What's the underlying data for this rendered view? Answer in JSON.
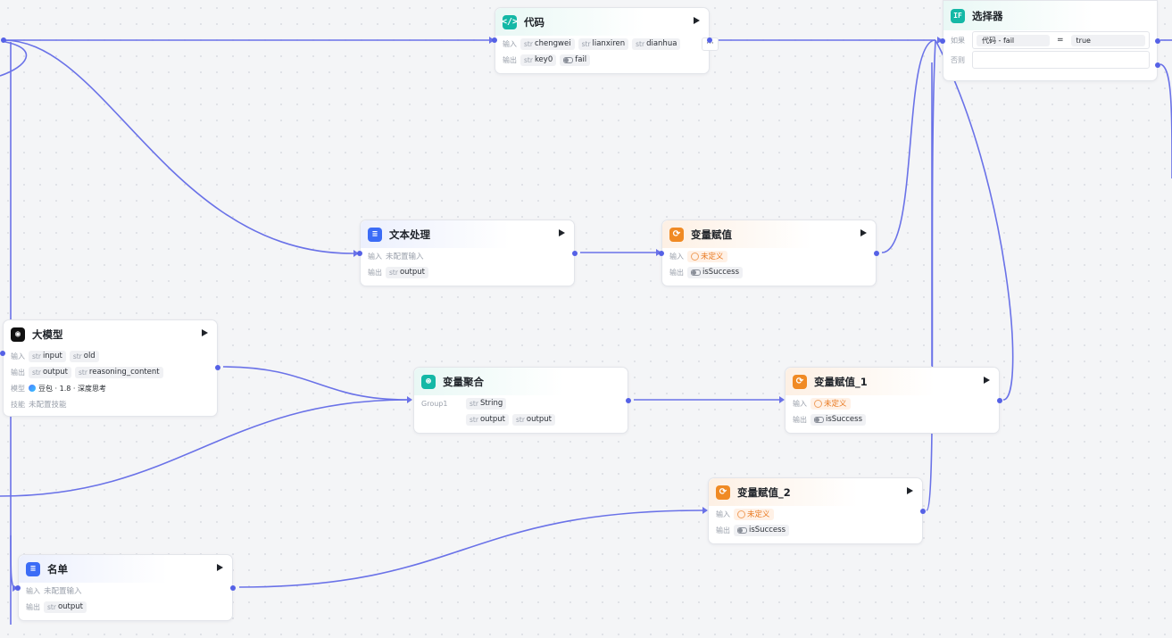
{
  "labels": {
    "input": "输入",
    "output": "输出",
    "model": "模型",
    "skill": "技能",
    "if": "如果",
    "else": "否则"
  },
  "nodes": {
    "code": {
      "title": "代码",
      "inputs": [
        {
          "type": "str",
          "name": "chengwei"
        },
        {
          "type": "str",
          "name": "lianxiren"
        },
        {
          "type": "str",
          "name": "dianhua"
        }
      ],
      "more": "···",
      "outputs": [
        {
          "type": "str",
          "name": "key0"
        },
        {
          "type": "bool",
          "name": "fail"
        }
      ]
    },
    "selector": {
      "title": "选择器",
      "icon_text": "IF",
      "condition_left": "代码 - fail",
      "operator": "=",
      "condition_right": "true"
    },
    "text_proc": {
      "title": "文本处理",
      "input_placeholder": "未配置输入",
      "outputs": [
        {
          "type": "str",
          "name": "output"
        }
      ]
    },
    "assign": {
      "title": "变量赋值",
      "input_value": "未定义",
      "output_name": "isSuccess"
    },
    "llm": {
      "title": "大模型",
      "inputs": [
        {
          "type": "str",
          "name": "input"
        },
        {
          "type": "str",
          "name": "old"
        }
      ],
      "outputs": [
        {
          "type": "str",
          "name": "output"
        },
        {
          "type": "str",
          "name": "reasoning_content"
        }
      ],
      "model_name": "豆包 · 1.8 · 深度思考",
      "skill_placeholder": "未配置技能"
    },
    "aggregate": {
      "title": "变量聚合",
      "group": "Group1",
      "group_type": {
        "type": "str",
        "name": "String"
      },
      "group_items": [
        {
          "type": "str",
          "name": "output"
        },
        {
          "type": "str",
          "name": "output"
        }
      ]
    },
    "assign1": {
      "title": "变量赋值_1",
      "input_value": "未定义",
      "output_name": "isSuccess"
    },
    "assign2": {
      "title": "变量赋值_2",
      "input_value": "未定义",
      "output_name": "isSuccess"
    },
    "list": {
      "title": "名单",
      "input_placeholder": "未配置输入",
      "outputs": [
        {
          "type": "str",
          "name": "output"
        }
      ]
    }
  },
  "colors": {
    "edge": "#5561e6",
    "teal": "#14b8a6",
    "blue": "#3b6cf6",
    "orange": "#f08a24"
  }
}
